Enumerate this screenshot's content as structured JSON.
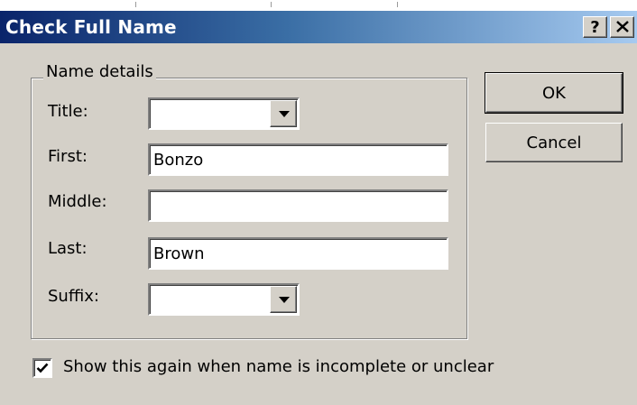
{
  "window": {
    "title": "Check Full Name",
    "help_glyph": "?",
    "close_glyph": "✕"
  },
  "group": {
    "label": "Name details"
  },
  "fields": {
    "title": {
      "label": "Title:",
      "value": ""
    },
    "first": {
      "label": "First:",
      "value": "Bonzo"
    },
    "middle": {
      "label": "Middle:",
      "value": ""
    },
    "last": {
      "label": "Last:",
      "value": "Brown"
    },
    "suffix": {
      "label": "Suffix:",
      "value": ""
    }
  },
  "buttons": {
    "ok": "OK",
    "cancel": "Cancel"
  },
  "options": {
    "show_again_label": "Show this again when name is incomplete or unclear",
    "show_again_checked": true
  },
  "colors": {
    "titlebar_start": "#0a246a",
    "titlebar_end": "#a6caf0",
    "dialog_face": "#d4d0c8"
  }
}
